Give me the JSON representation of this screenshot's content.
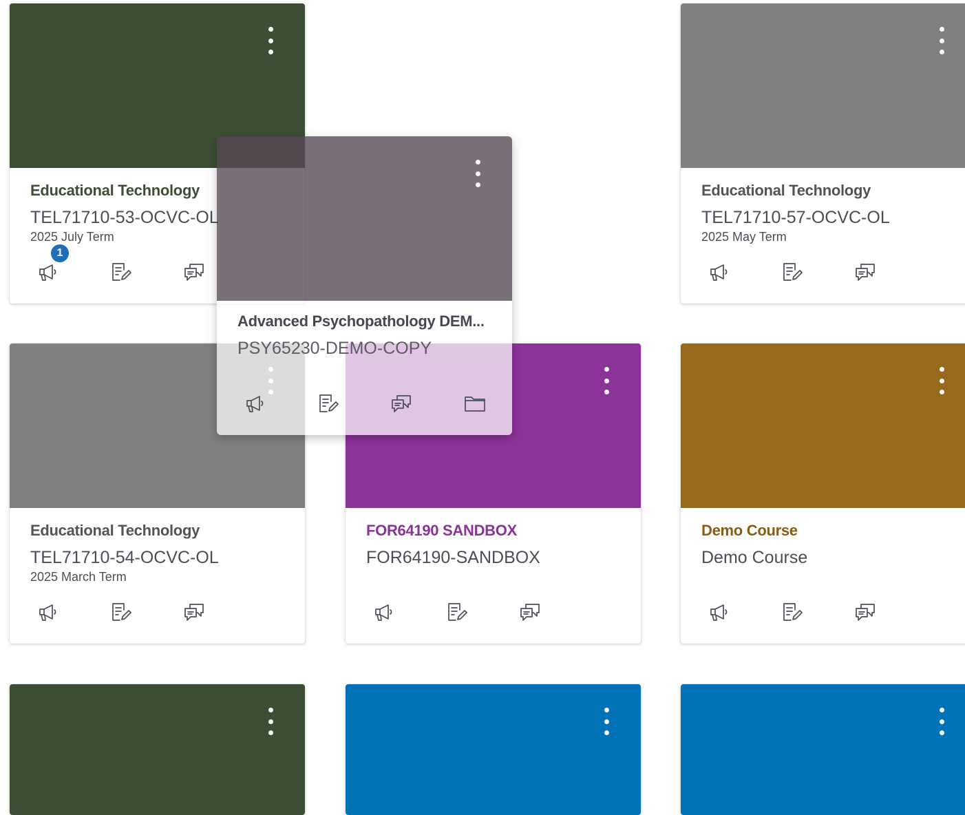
{
  "icons": {
    "announcements": "megaphone-icon",
    "assignments": "assignment-edit-icon",
    "discussions": "discussion-icon",
    "files": "folder-icon"
  },
  "cards": [
    {
      "name": "Educational Technology",
      "code": "TEL71710-53-OCVC-OL",
      "term": "2025 July Term",
      "color": "#3c4f35",
      "name_color": "#3c4f35",
      "badge": "1"
    },
    {
      "name": "Educational Technology",
      "code": "TEL71710-57-OCVC-OL",
      "term": "2025 May Term",
      "color": "#808080",
      "name_color": "#545454"
    },
    {
      "name": "Educational Technology",
      "code": "TEL71710-54-OCVC-OL",
      "term": "2025 March Term",
      "color": "#808080",
      "name_color": "#545454"
    },
    {
      "name": "FOR64190 SANDBOX",
      "code": "FOR64190-SANDBOX",
      "term": "",
      "color": "#8c3399",
      "name_color": "#8c3399"
    },
    {
      "name": "Demo Course",
      "code": "Demo Course",
      "term": "",
      "color": "#976a19",
      "name_color": "#8a5d10"
    },
    {
      "color": "#3c4f35"
    },
    {
      "color": "#0072b5"
    },
    {
      "color": "#0072b5"
    }
  ],
  "dragging_card": {
    "name": "Advanced Psychopathology DEM...",
    "code": "PSY65230-DEMO-COPY",
    "color": "#564655",
    "name_color": "#4b4455"
  }
}
